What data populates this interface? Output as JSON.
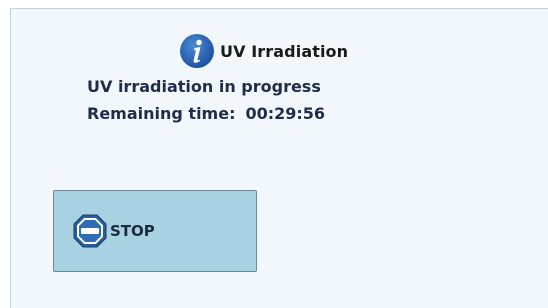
{
  "dialog": {
    "title": "UV Irradiation",
    "title_icon": "info-icon",
    "message": "UV irradiation in progress",
    "remaining_label": "Remaining time:",
    "remaining_time": "00:29:56"
  },
  "stop_button": {
    "label": "STOP",
    "icon": "stop-icon"
  },
  "colors": {
    "dialog_background": "#f2f7fc",
    "info_icon": "#1f5fb0",
    "button_background": "#a8d2e1",
    "stop_icon": "#2a5d9a"
  }
}
